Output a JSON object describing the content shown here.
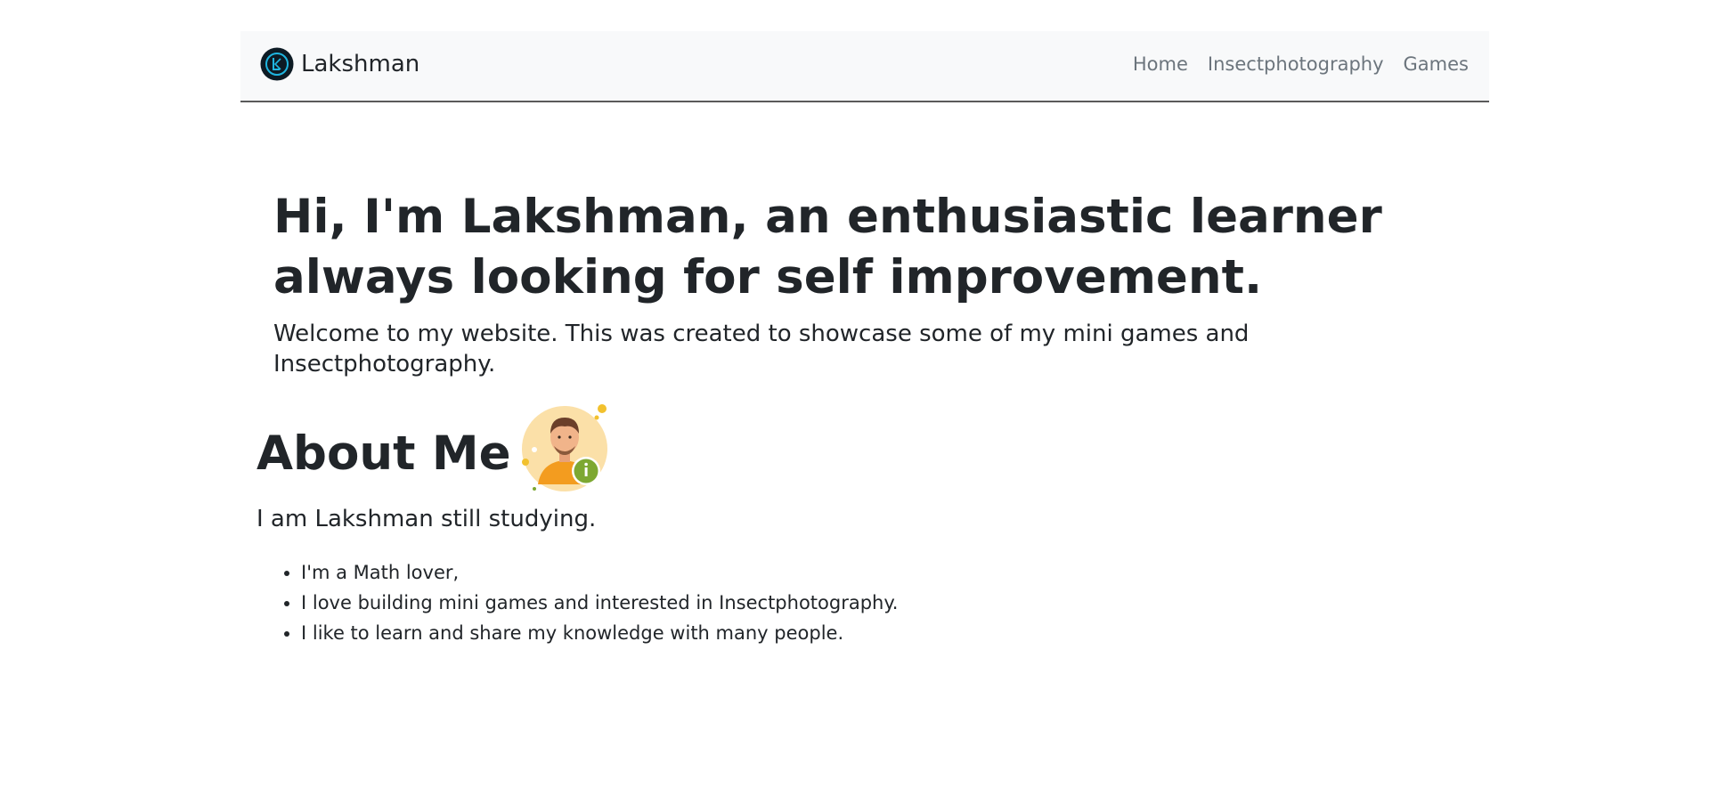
{
  "navbar": {
    "brand_name": "Lakshman",
    "logo_icon": "lk-circle-logo-icon",
    "links": [
      {
        "label": "Home"
      },
      {
        "label": "Insectphotography"
      },
      {
        "label": "Games"
      }
    ]
  },
  "hero": {
    "title": "Hi, I'm Lakshman, an enthusiastic learner always looking for self improvement.",
    "subtitle": "Welcome to my website. This was created to showcase some of my mini games and Insectphotography."
  },
  "about": {
    "heading": "About Me",
    "avatar_icon": "user-info-avatar-icon",
    "intro": "I am Lakshman still studying.",
    "items": [
      "I'm a Math lover,",
      "I love building mini games and interested in Insectphotography.",
      "I like to learn and share my knowledge with many people."
    ]
  },
  "colors": {
    "navbar_bg": "#f8f9fa",
    "nav_link": "#6c757d",
    "text": "#212529",
    "logo_accent": "#1fb6e0"
  }
}
